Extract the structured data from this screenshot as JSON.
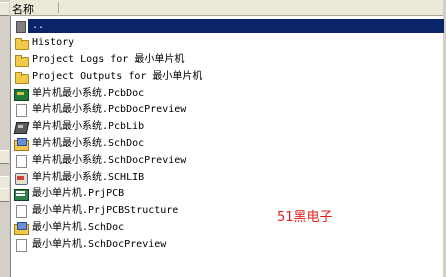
{
  "header": {
    "name_column": "名称"
  },
  "files": [
    {
      "label": "..",
      "icon": "parent-folder-icon",
      "selected": true
    },
    {
      "label": "History",
      "icon": "folder-icon"
    },
    {
      "label": "Project Logs for 最小单片机",
      "icon": "folder-icon"
    },
    {
      "label": "Project Outputs for 最小单片机",
      "icon": "folder-icon"
    },
    {
      "label": "单片机最小系统.PcbDoc",
      "icon": "pcb-document-icon"
    },
    {
      "label": "单片机最小系统.PcbDocPreview",
      "icon": "blank-document-icon"
    },
    {
      "label": "单片机最小系统.PcbLib",
      "icon": "pcb-library-icon"
    },
    {
      "label": "单片机最小系统.SchDoc",
      "icon": "schematic-document-icon"
    },
    {
      "label": "单片机最小系统.SchDocPreview",
      "icon": "blank-document-icon"
    },
    {
      "label": "单片机最小系统.SCHLIB",
      "icon": "schematic-library-icon"
    },
    {
      "label": "最小单片机.PrjPCB",
      "icon": "pcb-project-icon"
    },
    {
      "label": "最小单片机.PrjPCBStructure",
      "icon": "blank-document-icon"
    },
    {
      "label": "最小单片机.SchDoc",
      "icon": "schematic-document-icon"
    },
    {
      "label": "最小单片机.SchDocPreview",
      "icon": "blank-document-icon"
    }
  ],
  "watermark": "51黑电子",
  "colors": {
    "selection": "#0a246a",
    "watermark": "#e0201c",
    "header_bg": "#ece9d8"
  }
}
